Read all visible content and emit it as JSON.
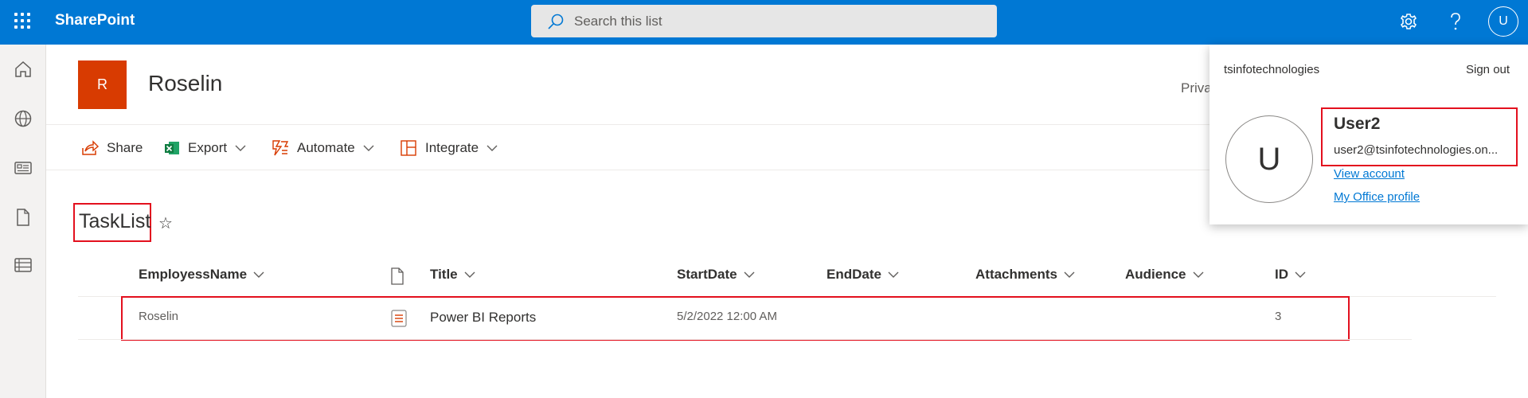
{
  "app": {
    "brand": "SharePoint",
    "accent_color": "#0078d4"
  },
  "search": {
    "placeholder": "Search this list"
  },
  "topbar_icons": [
    "waffle-icon",
    "gear-icon",
    "help-icon"
  ],
  "user_initial": "U",
  "left_rail": [
    "home-icon",
    "globe-icon",
    "news-icon",
    "document-icon",
    "list-icon"
  ],
  "site": {
    "logo_letter": "R",
    "logo_color": "#d83b01",
    "title": "Roselin",
    "privacy_text": "Priva"
  },
  "commands": {
    "share": "Share",
    "export": "Export",
    "automate": "Automate",
    "integrate": "Integrate"
  },
  "list": {
    "title": "TaskList",
    "columns": {
      "employess_name": "EmployessName",
      "title": "Title",
      "start_date": "StartDate",
      "end_date": "EndDate",
      "attachments": "Attachments",
      "audience": "Audience",
      "id": "ID"
    },
    "rows": [
      {
        "employess_name": "Roselin",
        "title": "Power BI Reports",
        "start_date": "5/2/2022 12:00 AM",
        "end_date": "",
        "attachments": "",
        "audience": "",
        "id": "3"
      }
    ]
  },
  "profile_panel": {
    "organization": "tsinfotechnologies",
    "sign_out": "Sign out",
    "avatar_initial": "U",
    "user_name": "User2",
    "email": "user2@tsinfotechnologies.on...",
    "view_account": "View account",
    "office_profile": "My Office profile"
  },
  "highlight_color": "#e3101e"
}
